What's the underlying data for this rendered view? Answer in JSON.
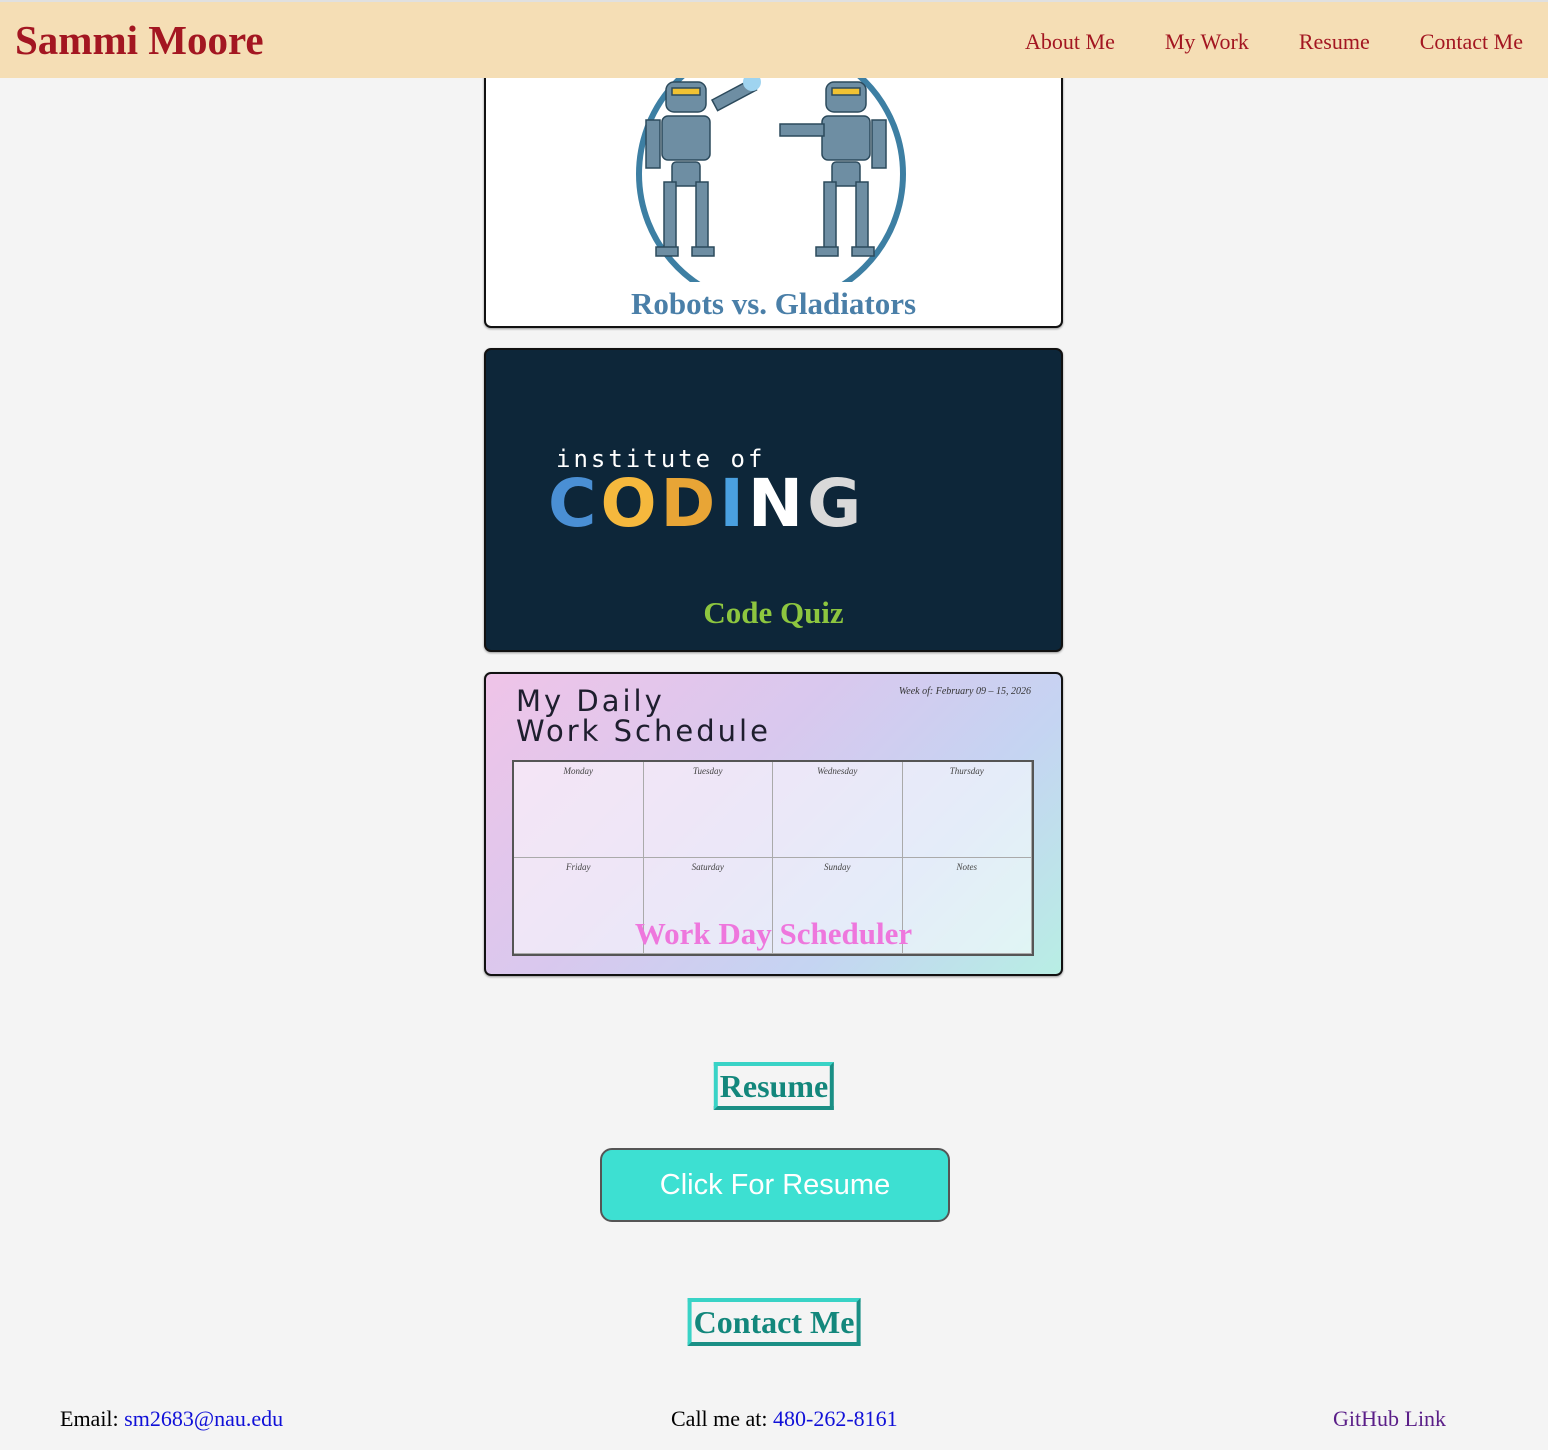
{
  "header": {
    "brand": "Sammi Moore",
    "nav": [
      "About Me",
      "My Work",
      "Resume",
      "Contact Me"
    ]
  },
  "projects": [
    {
      "title": "Robots vs. Gladiators"
    },
    {
      "title": "Code Quiz",
      "image_text_top": "institute of",
      "image_text_main": "CODING"
    },
    {
      "title": "Work Day Scheduler",
      "image_heading_line1": "My Daily",
      "image_heading_line2": "Work Schedule",
      "image_week": "Week of: February 09 – 15, 2026",
      "image_days": [
        "Monday",
        "Tuesday",
        "Wednesday",
        "Thursday",
        "Friday",
        "Saturday",
        "Sunday",
        "Notes"
      ]
    }
  ],
  "resume": {
    "heading": "Resume",
    "button_label": "Click For Resume"
  },
  "contact": {
    "heading": "Contact Me",
    "email_label": "Email: ",
    "email": "sm2683@nau.edu",
    "phone_label": "Call me at: ",
    "phone": "480-262-8161",
    "github": "GitHub Link"
  },
  "colors": {
    "header_bg": "#f5deb5",
    "brand": "#a31621",
    "robots_title": "#4a7fa8",
    "quiz_title": "#8dc63f",
    "scheduler_title": "#ee77dd",
    "section_heading": "#13877c",
    "resume_button": "#3de0d2"
  }
}
